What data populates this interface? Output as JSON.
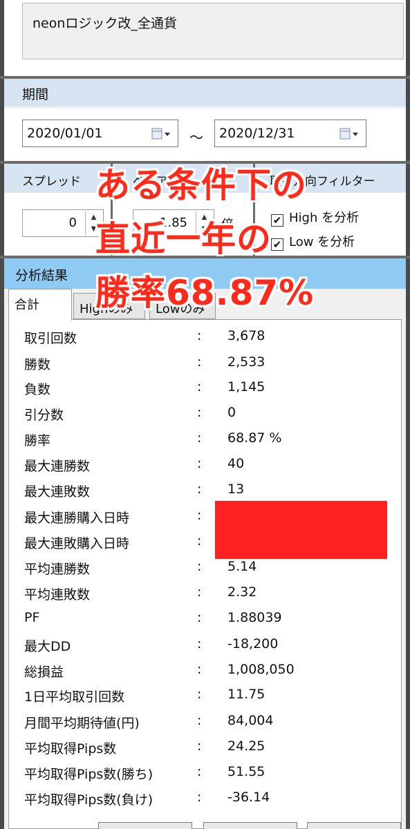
{
  "logic_name": "neonロジック改_全通貨",
  "period": {
    "header": "期間",
    "start_date": "2020/01/01",
    "separator": "～",
    "end_date": "2020/12/31"
  },
  "settings": {
    "spread_label": "スプレッド",
    "spread_value": "0",
    "payout_label": "ペイアウト",
    "payout_value": "1.85",
    "payout_unit": "倍",
    "filter_label": "取引方向フィルター",
    "high_label": "High を分析",
    "high_checked": true,
    "low_label": "Low を分析",
    "low_checked": true
  },
  "results": {
    "header": "分析結果",
    "tabs": [
      "合計",
      "Highのみ",
      "Lowのみ"
    ],
    "active_tab": "合計",
    "rows": [
      {
        "label": "取引回数",
        "value": "3,678"
      },
      {
        "label": "勝数",
        "value": "2,533"
      },
      {
        "label": "負数",
        "value": "1,145"
      },
      {
        "label": "引分数",
        "value": "0"
      },
      {
        "label": "勝率",
        "value": "68.87 %"
      },
      {
        "label": "最大連勝数",
        "value": "40"
      },
      {
        "label": "最大連敗数",
        "value": "13"
      },
      {
        "label": "最大連勝購入日時",
        "value": ""
      },
      {
        "label": "最大連敗購入日時",
        "value": ""
      },
      {
        "label": "平均連勝数",
        "value": "5.14"
      },
      {
        "label": "平均連敗数",
        "value": "2.32"
      },
      {
        "label": "PF",
        "value": "1.88039"
      },
      {
        "label": "最大DD",
        "value": "-18,200"
      },
      {
        "label": "総損益",
        "value": "1,008,050"
      },
      {
        "label": "1日平均取引回数",
        "value": "11.75"
      },
      {
        "label": "月間平均期待値(円)",
        "value": "84,004"
      },
      {
        "label": "平均取得Pips数",
        "value": "24.25"
      },
      {
        "label": "平均取得Pips数(勝ち)",
        "value": "51.55"
      },
      {
        "label": "平均取得Pips数(負け)",
        "value": "-36.14"
      }
    ],
    "colon": ":"
  },
  "overlay": {
    "line1": "ある条件下の",
    "line2": "直近一年の",
    "line3": "勝率68.87%"
  },
  "colors": {
    "overlay_text": "#ff2a1a",
    "redaction": "#ff2020",
    "section_header": "#d7e4f1",
    "result_header": "#8fcaf2"
  }
}
